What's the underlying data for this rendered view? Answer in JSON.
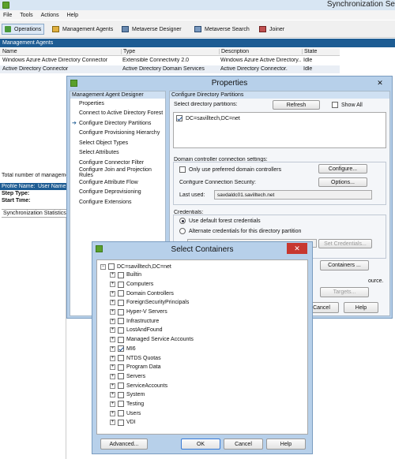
{
  "app": {
    "title": "Synchronization Se"
  },
  "menu": [
    "File",
    "Tools",
    "Actions",
    "Help"
  ],
  "toolbar": [
    "Operations",
    "Management Agents",
    "Metaverse Designer",
    "Metaverse Search",
    "Joiner"
  ],
  "agents": {
    "section_title": "Management Agents",
    "columns": [
      "Name",
      "Type",
      "Description",
      "State"
    ],
    "rows": [
      [
        "Windows Azure Active Directory Connector",
        "Extensible Connectivity 2.0",
        "Windows Azure Active Directory...",
        "Idle"
      ],
      [
        "Active Directory Connector",
        "Active Directory Domain Services",
        "Active Directory Connector.",
        "Idle"
      ]
    ]
  },
  "background": {
    "total_text": "Total number of manageme",
    "profile_name": "Profile Name:",
    "user_name": "User Name",
    "step_type": "Step Type:",
    "start_time": "Start Time:",
    "sync_stats": "Synchronization Statistics"
  },
  "properties": {
    "title": "Properties",
    "nav_title": "Management Agent Designer",
    "nav_items": [
      "Properties",
      "Connect to Active Directory Forest",
      "Configure Directory Partitions",
      "Configure Provisioning Hierarchy",
      "Select Object Types",
      "Select Attributes",
      "Configure Connector Filter",
      "Configure Join and Projection Rules",
      "Configure Attribute Flow",
      "Configure Deprovisioning",
      "Configure Extensions"
    ],
    "panel_title": "Configure Directory Partitions",
    "select_label": "Select directory partitions:",
    "refresh": "Refresh",
    "show_all": "Show All",
    "partition": "DC=savilltech,DC=net",
    "dc_group": "Domain controller connection settings:",
    "only_preferred": "Only use preferred domain controllers",
    "configure": "Configure...",
    "conn_security": "Configure Connection Security:",
    "options": "Options...",
    "last_used_label": "Last used:",
    "last_used": "savdaldc01.savilltech.net",
    "credentials": "Credentials:",
    "default_creds": "Use default forest credentials",
    "alt_creds": "Alternate credentials for this directory partition",
    "set_credentials": "Set Credentials...",
    "containers": "Containers ...",
    "source_text": "ource.",
    "targets": "Targets...",
    "cancel": "Cancel",
    "help": "Help"
  },
  "containers": {
    "title": "Select Containers",
    "root": "DC=savilltech,DC=net",
    "items": [
      {
        "label": "Builtin",
        "checked": false
      },
      {
        "label": "Computers",
        "checked": false
      },
      {
        "label": "Domain Controllers",
        "checked": false
      },
      {
        "label": "ForeignSecurityPrincipals",
        "checked": false
      },
      {
        "label": "Hyper-V Servers",
        "checked": false
      },
      {
        "label": "Infrastructure",
        "checked": false
      },
      {
        "label": "LostAndFound",
        "checked": false
      },
      {
        "label": "Managed Service Accounts",
        "checked": false
      },
      {
        "label": "MI6",
        "checked": true
      },
      {
        "label": "NTDS Quotas",
        "checked": false
      },
      {
        "label": "Program Data",
        "checked": false
      },
      {
        "label": "Servers",
        "checked": false
      },
      {
        "label": "ServiceAccounts",
        "checked": false
      },
      {
        "label": "System",
        "checked": false
      },
      {
        "label": "Testing",
        "checked": false
      },
      {
        "label": "Users",
        "checked": false
      },
      {
        "label": "VDI",
        "checked": false
      }
    ],
    "advanced": "Advanced...",
    "ok": "OK",
    "cancel": "Cancel",
    "help": "Help"
  },
  "colors": {
    "close_red": "#c7372f",
    "dialog_frame": "#b7d0ea",
    "pane_blue": "#cfe0f2",
    "title_frame": "#c7dcf0"
  }
}
